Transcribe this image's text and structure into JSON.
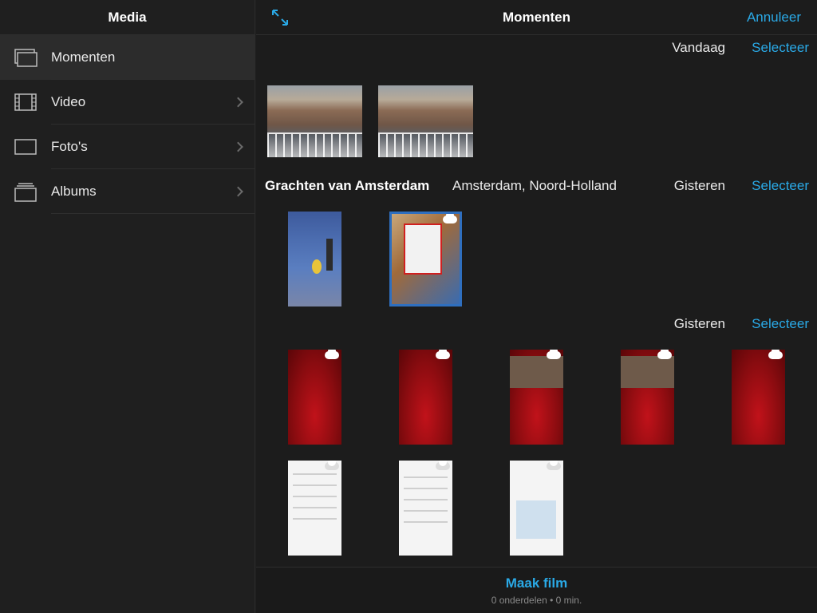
{
  "sidebar": {
    "title": "Media",
    "items": [
      {
        "label": "Momenten",
        "icon": "moments-icon"
      },
      {
        "label": "Video",
        "icon": "film-icon"
      },
      {
        "label": "Foto's",
        "icon": "photo-icon"
      },
      {
        "label": "Albums",
        "icon": "albums-icon"
      }
    ]
  },
  "nav": {
    "title": "Momenten",
    "cancel": "Annuleer",
    "expand_icon": "expand-icon"
  },
  "sections": [
    {
      "title": "",
      "location": "",
      "date": "Vandaag",
      "select": "Selecteer"
    },
    {
      "title": "Grachten van Amsterdam",
      "location": "Amsterdam, Noord-Holland",
      "date": "Gisteren",
      "select": "Selecteer"
    },
    {
      "title": "",
      "location": "",
      "date": "Gisteren",
      "select": "Selecteer"
    }
  ],
  "bottom": {
    "action": "Maak film",
    "status": "0 onderdelen • 0 min."
  },
  "colors": {
    "accent": "#2aa9e6",
    "background": "#1c1c1c"
  }
}
